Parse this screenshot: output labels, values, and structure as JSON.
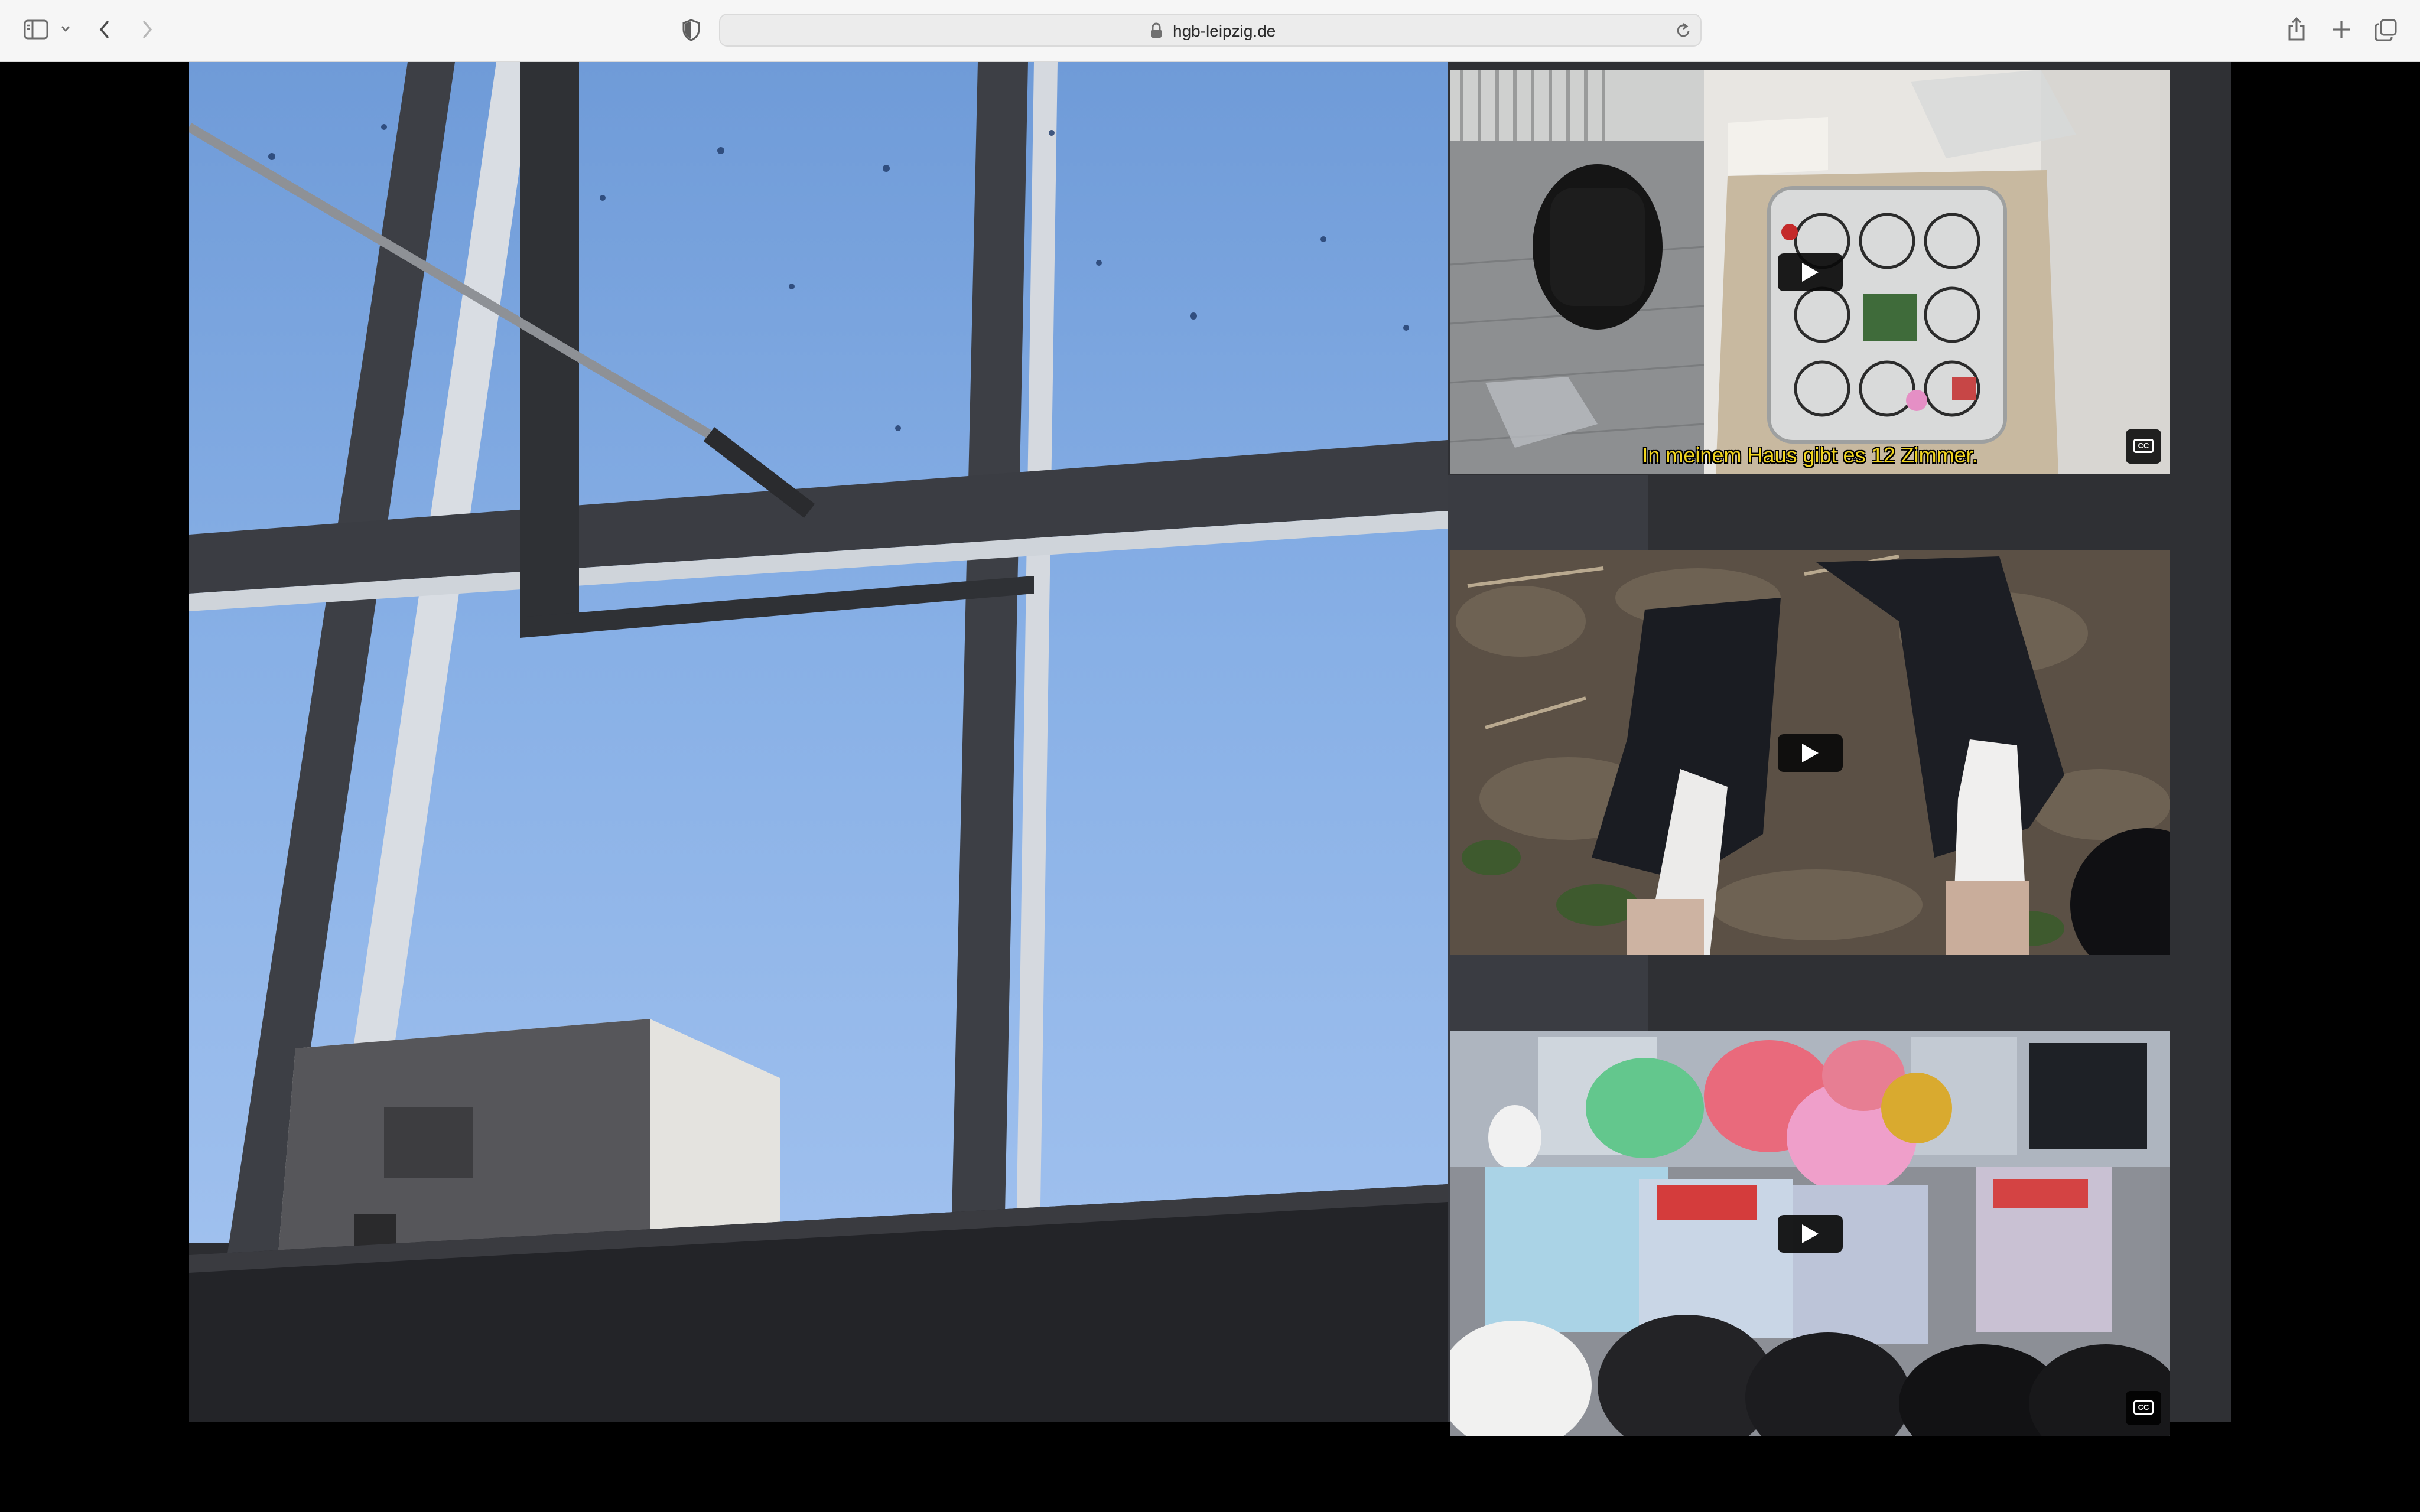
{
  "browser": {
    "url": "hgb-leipzig.de",
    "icons": {
      "sidebar": "sidebar-icon",
      "sidebar_menu": "chevron-down-icon",
      "back": "chevron-left-icon",
      "forward": "chevron-right-icon",
      "privacy": "shield-icon",
      "lock": "lock-icon",
      "reload": "reload-icon",
      "share": "share-icon",
      "new_tab": "plus-icon",
      "tabs": "tabs-overview-icon"
    }
  },
  "videos": [
    {
      "subtitle": "In meinem Haus gibt es 12 Zimmer.",
      "has_cc": true
    },
    {
      "subtitle": "",
      "has_cc": false
    },
    {
      "subtitle": "",
      "has_cc": true
    }
  ],
  "controls": {
    "cc_label": "CC"
  },
  "colors": {
    "toolbar": "#f6f6f6",
    "page_background": "#000000",
    "subtitle": "#f2d51f",
    "sky": "#7fa6df"
  }
}
